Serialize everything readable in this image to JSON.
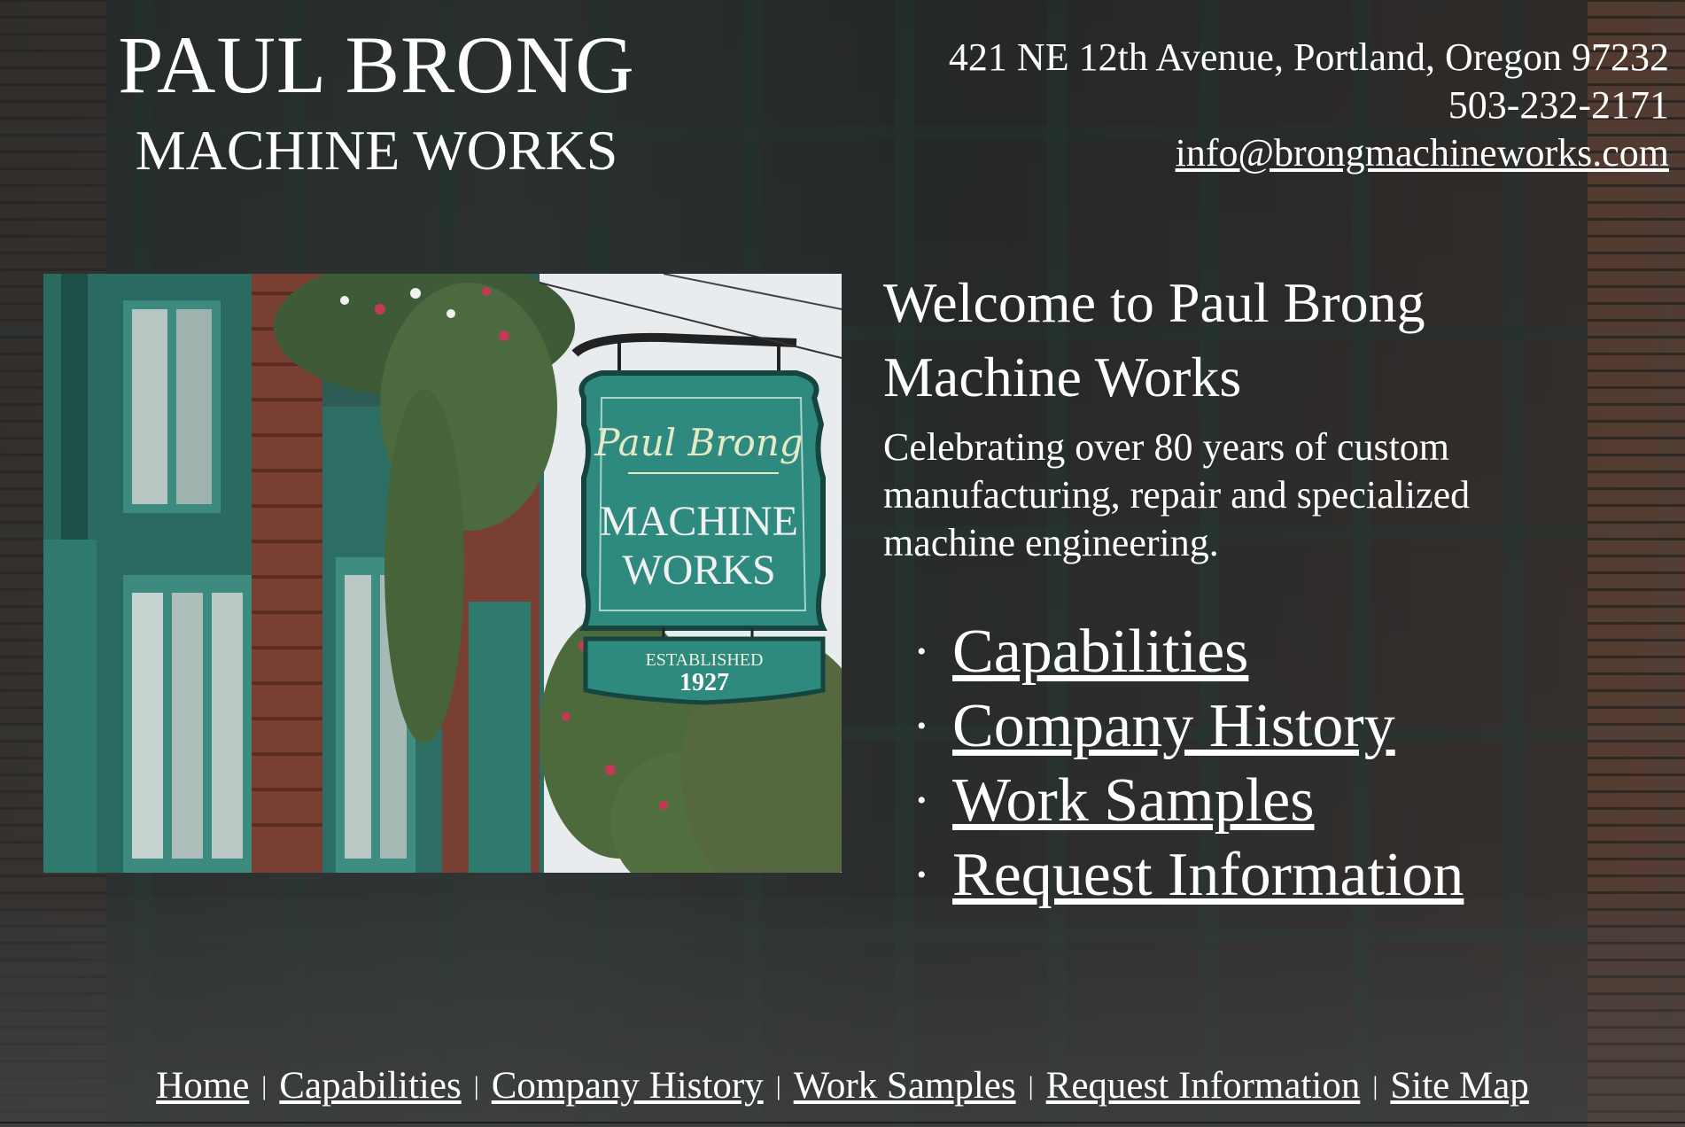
{
  "brand": {
    "line1": "PAUL BRONG",
    "line2": "MACHINE WORKS"
  },
  "contact": {
    "address": "421 NE 12th Avenue, Portland, Oregon 97232",
    "phone": "503-232-2171",
    "email": "info@brongmachineworks.com"
  },
  "photo": {
    "sign_logo": "Paul Brong",
    "sign_line1": "MACHINE",
    "sign_line2": "WORKS",
    "plaque_line1": "ESTABLISHED",
    "plaque_line2": "1927"
  },
  "welcome": {
    "heading": "Welcome to Paul Brong Machine Works",
    "text": "Celebrating over 80 years of custom manufacturing, repair and specialized machine engineering."
  },
  "main_links": [
    {
      "label": "Capabilities"
    },
    {
      "label": "Company History"
    },
    {
      "label": "Work Samples"
    },
    {
      "label": "Request Information"
    }
  ],
  "footer_nav": [
    {
      "label": "Home"
    },
    {
      "label": "Capabilities"
    },
    {
      "label": "Company History"
    },
    {
      "label": "Work Samples"
    },
    {
      "label": "Request Information"
    },
    {
      "label": "Site Map"
    }
  ],
  "bullet_glyph": "•",
  "separator_glyph": "|",
  "colors": {
    "text": "#ffffff",
    "sign_green": "#2e8a7e",
    "frame_green": "#2d5c55",
    "brick": "#7a3f33"
  }
}
